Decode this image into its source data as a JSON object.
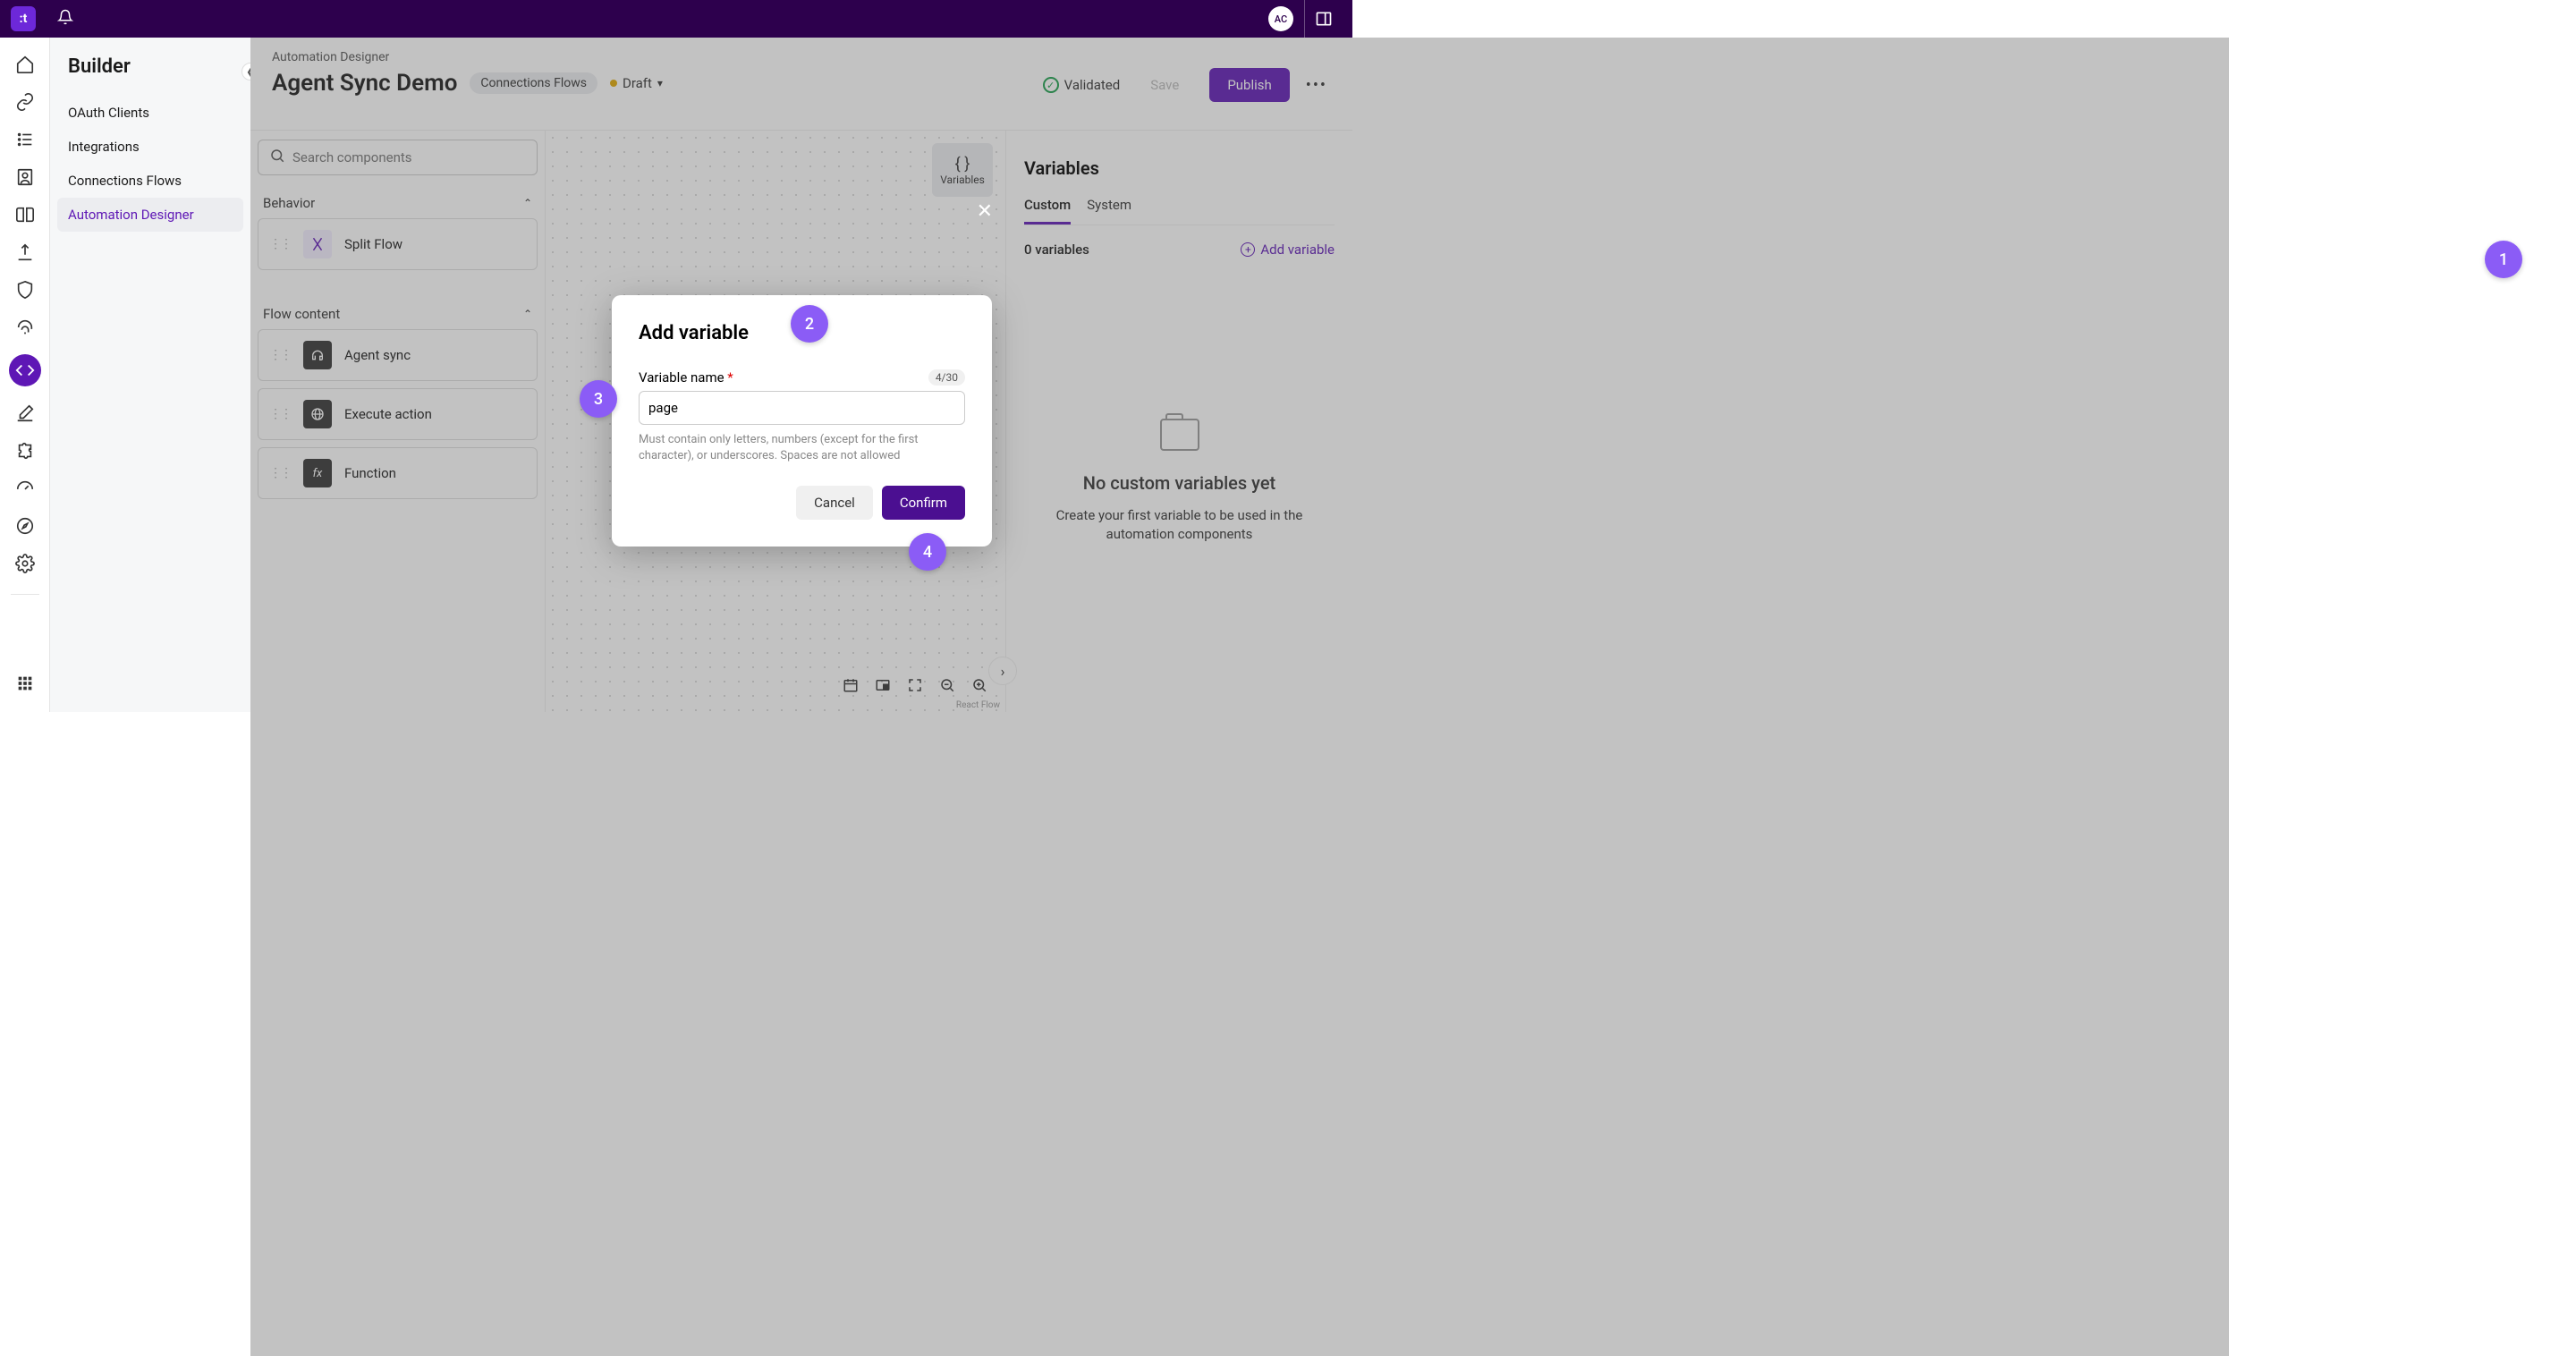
{
  "topbar": {
    "avatar": "AC"
  },
  "sidebar": {
    "title": "Builder",
    "items": [
      "OAuth Clients",
      "Integrations",
      "Connections Flows",
      "Automation Designer"
    ],
    "active_index": 3
  },
  "header": {
    "breadcrumb": "Automation Designer",
    "title": "Agent Sync Demo",
    "chip": "Connections Flows",
    "status": "Draft",
    "validated": "Validated",
    "save": "Save",
    "publish": "Publish"
  },
  "palette": {
    "search_placeholder": "Search components",
    "categories": [
      {
        "name": "Behavior",
        "items": [
          {
            "label": "Split Flow",
            "icon": "split"
          }
        ]
      },
      {
        "name": "Flow content",
        "items": [
          {
            "label": "Agent sync",
            "icon": "headset"
          },
          {
            "label": "Execute action",
            "icon": "globe"
          },
          {
            "label": "Function",
            "icon": "fx"
          }
        ]
      }
    ]
  },
  "canvas": {
    "variables_block": "Variables",
    "attribution": "React Flow"
  },
  "right_panel": {
    "title": "Variables",
    "tabs": [
      "Custom",
      "System"
    ],
    "active_tab": 0,
    "count": "0 variables",
    "add_link": "Add variable",
    "empty_title": "No custom variables yet",
    "empty_sub": "Create your first variable to be used in the automation components"
  },
  "modal": {
    "title": "Add variable",
    "field_label": "Variable name",
    "char_count": "4/30",
    "value": "page",
    "hint": "Must contain only letters, numbers (except for the first character), or underscores. Spaces are not allowed",
    "cancel": "Cancel",
    "confirm": "Confirm"
  },
  "badges": [
    "1",
    "2",
    "3",
    "4"
  ]
}
